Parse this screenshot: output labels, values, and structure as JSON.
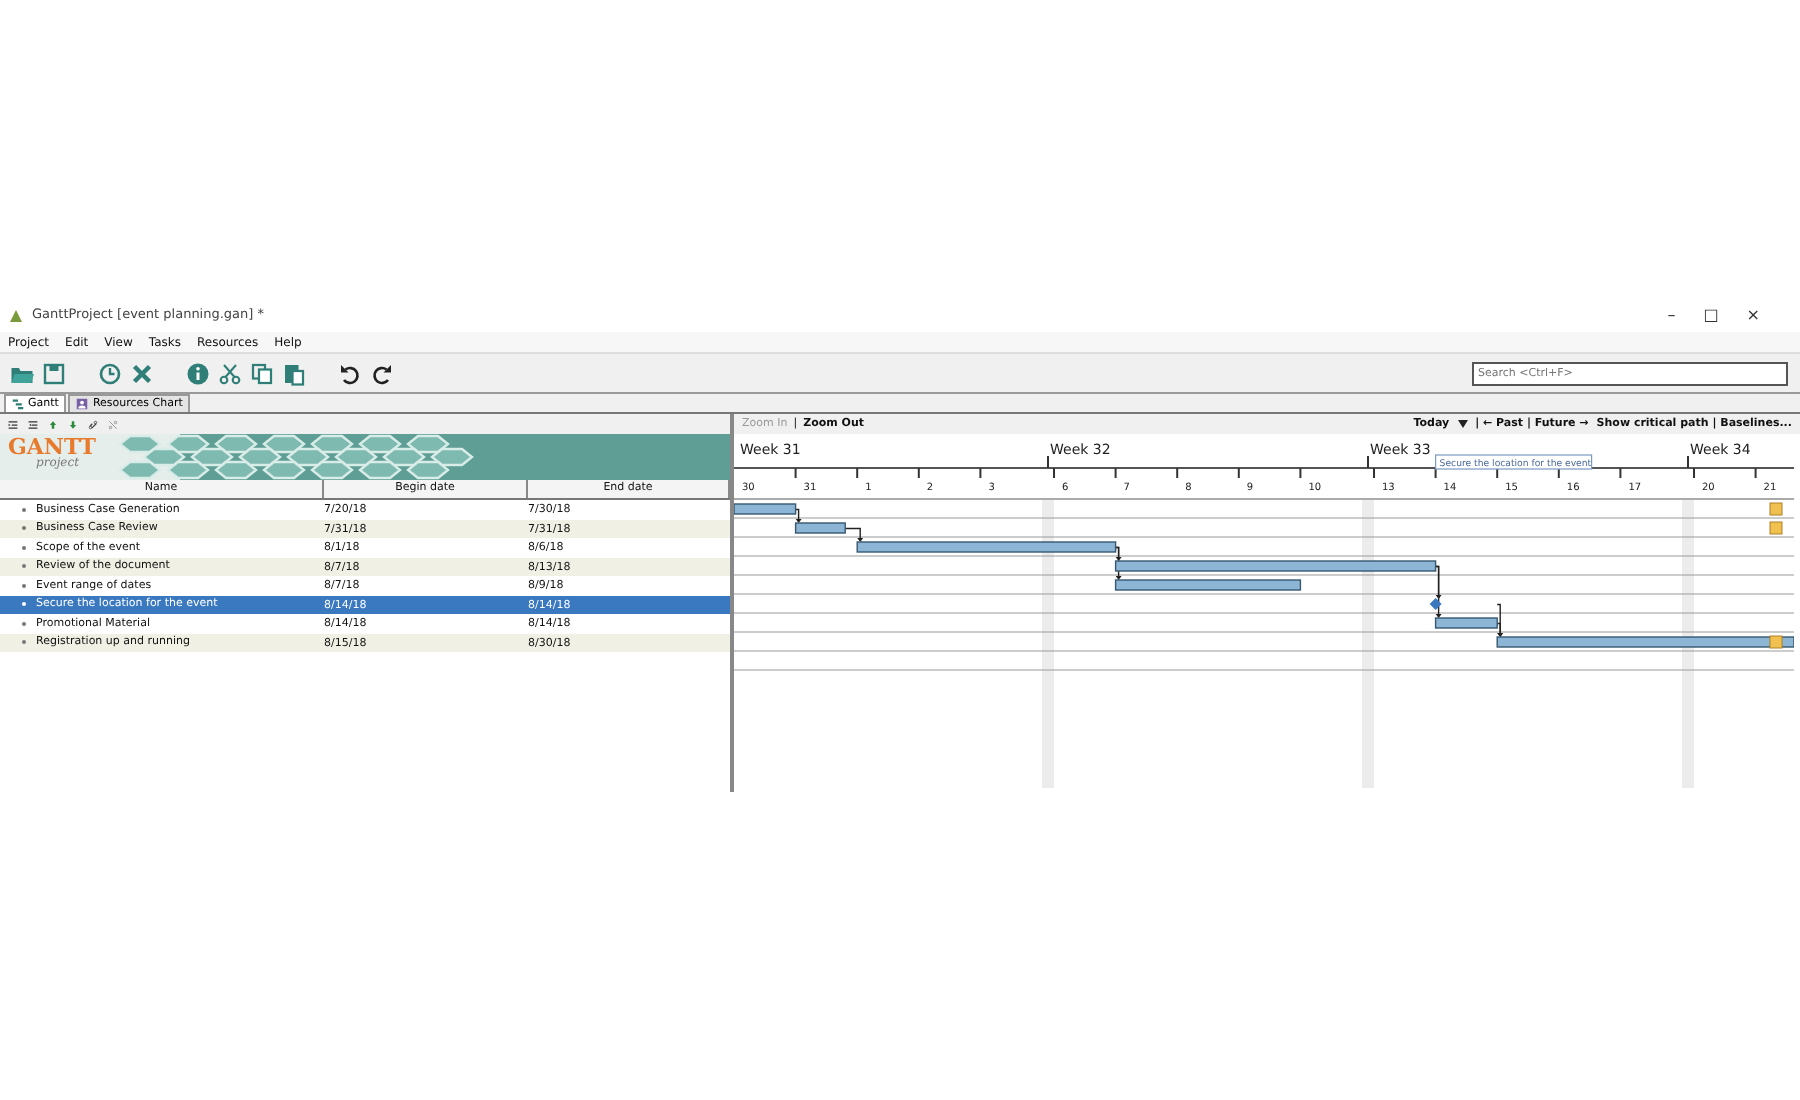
{
  "window": {
    "title": "GanttProject [event planning.gan] *",
    "controls": [
      "–",
      "□",
      "×"
    ]
  },
  "menu": [
    "Project",
    "Edit",
    "View",
    "Tasks",
    "Resources",
    "Help"
  ],
  "toolbar": [
    {
      "kind": "open"
    },
    {
      "kind": "save"
    },
    {
      "kind": "clock"
    },
    {
      "kind": "delete"
    },
    {
      "kind": "info"
    },
    {
      "kind": "cut"
    },
    {
      "kind": "copy"
    },
    {
      "kind": "paste"
    },
    {
      "kind": "undo"
    },
    {
      "kind": "redo"
    }
  ],
  "search": {
    "placeholder": "Search <Ctrl+F>"
  },
  "tabs": [
    {
      "label": "Gantt",
      "kind": "gantt",
      "selected": true
    },
    {
      "label": "Resources Chart",
      "kind": "resources",
      "selected": false
    }
  ],
  "tree_toolbar": [
    {
      "kind": "outdent"
    },
    {
      "kind": "indent"
    },
    {
      "kind": "up"
    },
    {
      "kind": "down"
    },
    {
      "kind": "link"
    },
    {
      "kind": "unlink"
    }
  ],
  "logo": {
    "title": "GANTT",
    "subtitle": "project"
  },
  "table": {
    "columns": [
      "Name",
      "Begin date",
      "End date"
    ],
    "rows": [
      {
        "name": "Business Case Generation",
        "begin": "7/20/18",
        "end": "7/30/18",
        "kind": "task",
        "selected": false,
        "edge_marker": true,
        "has_predecessor": false
      },
      {
        "name": "Business Case Review",
        "begin": "7/31/18",
        "end": "7/31/18",
        "kind": "task",
        "selected": false,
        "edge_marker": true,
        "has_predecessor": true
      },
      {
        "name": "Scope of the event",
        "begin": "8/1/18",
        "end": "8/6/18",
        "kind": "task",
        "selected": false,
        "edge_marker": false,
        "has_predecessor": true
      },
      {
        "name": "Review of the document",
        "begin": "8/7/18",
        "end": "8/13/18",
        "kind": "task",
        "selected": false,
        "edge_marker": false,
        "has_predecessor": true
      },
      {
        "name": "Event range of dates",
        "begin": "8/7/18",
        "end": "8/9/18",
        "kind": "task",
        "selected": false,
        "edge_marker": false,
        "has_predecessor": true
      },
      {
        "name": "Secure the location for the event",
        "begin": "8/14/18",
        "end": "8/14/18",
        "kind": "milestone",
        "selected": true,
        "edge_marker": false,
        "has_predecessor": true
      },
      {
        "name": "Promotional Material",
        "begin": "8/14/18",
        "end": "8/14/18",
        "kind": "task",
        "selected": false,
        "edge_marker": false,
        "has_predecessor": true
      },
      {
        "name": "Registration up and running",
        "begin": "8/15/18",
        "end": "8/30/18",
        "kind": "task",
        "selected": false,
        "edge_marker": true,
        "has_predecessor": true
      }
    ]
  },
  "gantt": {
    "zoom_in": "Zoom In",
    "zoom_sep": "|",
    "zoom_out": "Zoom Out",
    "today": "Today",
    "nav": "| ← Past | Future →",
    "options": "Show critical path | Baselines...",
    "weeks": [
      "Week 31",
      "Week 32",
      "Week 33",
      "Week 34"
    ],
    "days": [
      "30",
      "31",
      "1",
      "2",
      "3",
      "6",
      "7",
      "8",
      "9",
      "10",
      "13",
      "14",
      "15",
      "16",
      "17",
      "20",
      "21"
    ],
    "tooltip": "Secure the location for the event"
  }
}
